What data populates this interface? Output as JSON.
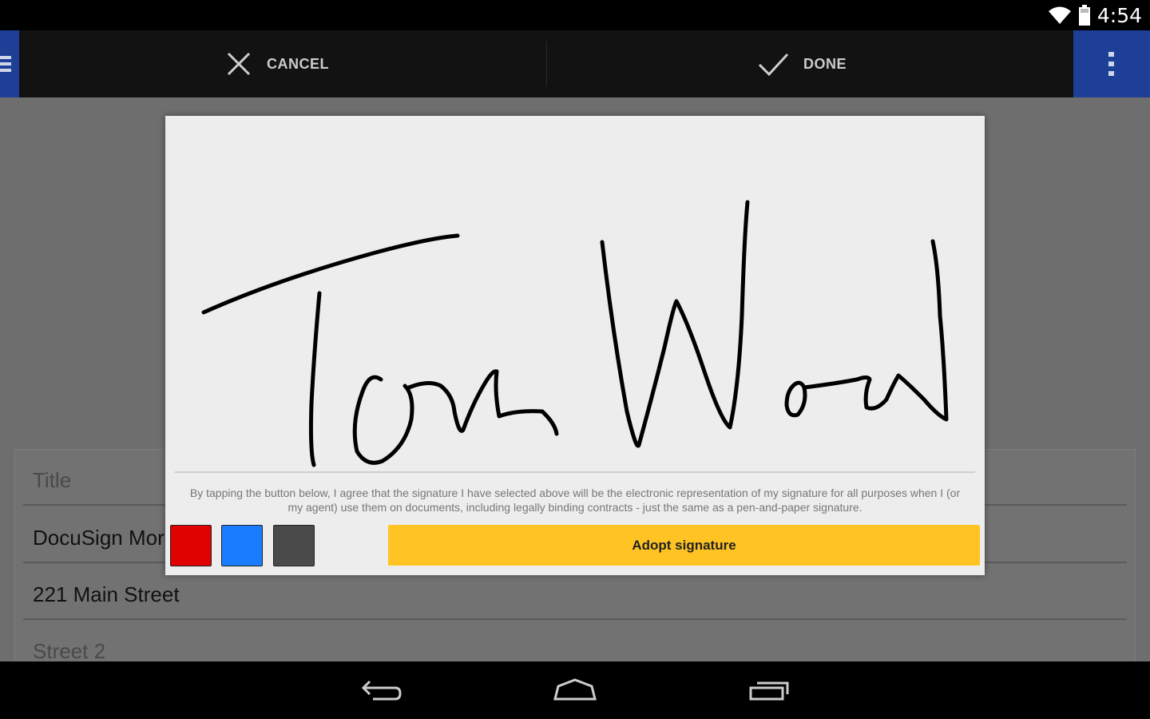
{
  "status_bar": {
    "time": "4:54"
  },
  "action_bar": {
    "cancel_label": "CANCEL",
    "done_label": "DONE"
  },
  "form": {
    "title_placeholder": "Title",
    "company_value": "DocuSign Mor",
    "street_value": "221 Main Street",
    "street2_placeholder": "Street 2"
  },
  "dialog": {
    "disclaimer": "By tapping the button below, I agree that the signature I have selected above will be the electronic representation of my signature for all purposes when I (or my agent) use them on documents, including legally binding contracts - just the same as a pen-and-paper signature.",
    "adopt_label": "Adopt signature",
    "pen_colors": [
      {
        "name": "red",
        "color": "#e00000"
      },
      {
        "name": "blue",
        "color": "#1a7dff"
      },
      {
        "name": "dark-gray",
        "color": "#4a4a4a"
      }
    ]
  },
  "colors": {
    "accent_blue": "#1d3f95",
    "adopt_yellow": "#ffc423"
  }
}
